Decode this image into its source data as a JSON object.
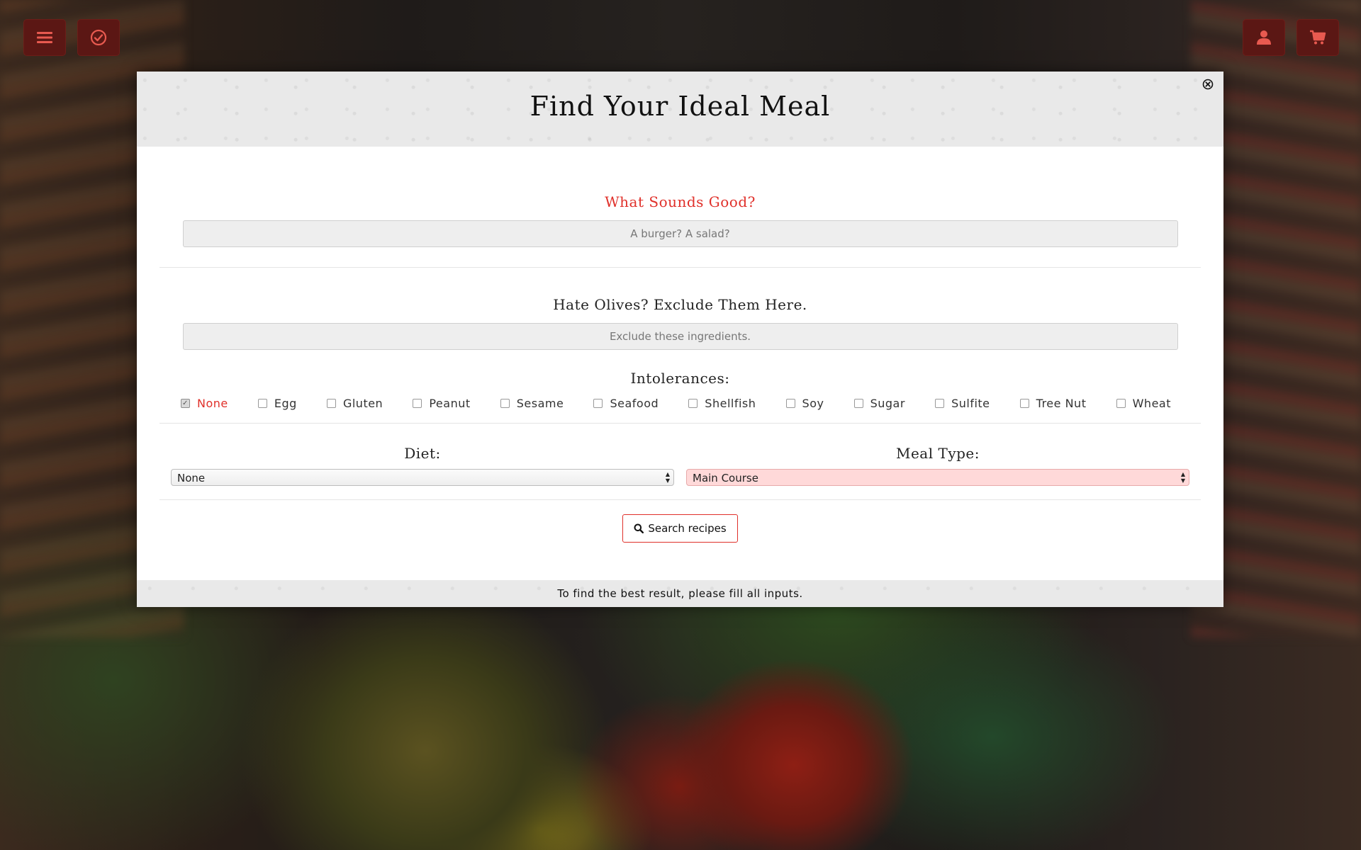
{
  "top_bar": {
    "left_buttons": [
      {
        "icon": "hamburger-menu-icon"
      },
      {
        "icon": "check-circle-icon"
      }
    ],
    "right_buttons": [
      {
        "icon": "user-icon"
      },
      {
        "icon": "shopping-cart-icon"
      }
    ],
    "button_color": "#5b1714"
  },
  "modal": {
    "title": "Find Your Ideal Meal",
    "close_icon": "close-circle-icon",
    "query": {
      "label": "What Sounds Good?",
      "placeholder": "A burger? A salad?",
      "value": ""
    },
    "exclude": {
      "label": "Hate Olives? Exclude Them Here.",
      "placeholder": "Exclude these ingredients.",
      "value": ""
    },
    "intolerances": {
      "label": "Intolerances:",
      "options": [
        {
          "label": "None",
          "checked": true
        },
        {
          "label": "Egg",
          "checked": false
        },
        {
          "label": "Gluten",
          "checked": false
        },
        {
          "label": "Peanut",
          "checked": false
        },
        {
          "label": "Sesame",
          "checked": false
        },
        {
          "label": "Seafood",
          "checked": false
        },
        {
          "label": "Shellfish",
          "checked": false
        },
        {
          "label": "Soy",
          "checked": false
        },
        {
          "label": "Sugar",
          "checked": false
        },
        {
          "label": "Sulfite",
          "checked": false
        },
        {
          "label": "Tree Nut",
          "checked": false
        },
        {
          "label": "Wheat",
          "checked": false
        }
      ]
    },
    "diet": {
      "label": "Diet:",
      "selected": "None"
    },
    "meal_type": {
      "label": "Meal Type:",
      "selected": "Main Course"
    },
    "search_button": {
      "label": "Search recipes",
      "icon": "search-icon"
    },
    "footer": "To find the best result, please fill all inputs."
  },
  "colors": {
    "accent_red": "#e0302a",
    "select_highlight": "#ffd9d9"
  }
}
